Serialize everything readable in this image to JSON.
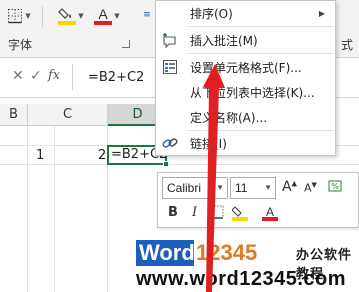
{
  "ribbon": {
    "font_group_label": "字体",
    "right_group_label": "式",
    "icons": [
      "borders-icon",
      "fill-color-icon",
      "font-color-icon"
    ]
  },
  "formula_bar": {
    "cancel_glyph": "✕",
    "confirm_glyph": "✓",
    "fx_label": "fx",
    "formula": "=B2+C2"
  },
  "columns": [
    "B",
    "C",
    "D"
  ],
  "cells": {
    "b2": "1",
    "c2": "2",
    "d2": "=B2+C2"
  },
  "context_menu": {
    "items": [
      {
        "label": "排序(O)",
        "icon": "none",
        "submenu": true
      },
      {
        "label": "插入批注(M)",
        "icon": "insert-comment-icon",
        "submenu": false
      },
      {
        "label": "设置单元格格式(F)...",
        "icon": "format-cells-icon",
        "submenu": false
      },
      {
        "label": "从下拉列表中选择(K)...",
        "icon": "none",
        "submenu": false
      },
      {
        "label": "定义名称(A)...",
        "icon": "none",
        "submenu": false
      },
      {
        "label": "链接(I)",
        "icon": "link-icon",
        "submenu": false
      }
    ]
  },
  "mini_toolbar": {
    "font_name": "Calibri",
    "font_size": "11",
    "grow_font": "A",
    "shrink_font": "A",
    "bold": "B",
    "italic": "I",
    "font_color_letter": "A"
  },
  "watermark": {
    "brand": "Word",
    "brand_num": "12345",
    "tagline": "办公软件教程",
    "url": "www.word12345.com"
  },
  "colors": {
    "accent_green": "#217346",
    "arrow_red": "#e02020",
    "fill_yellow": "#ffd400",
    "font_red": "#e02020",
    "brand_blue": "#1a5fbd",
    "brand_orange": "#e07a1f"
  }
}
